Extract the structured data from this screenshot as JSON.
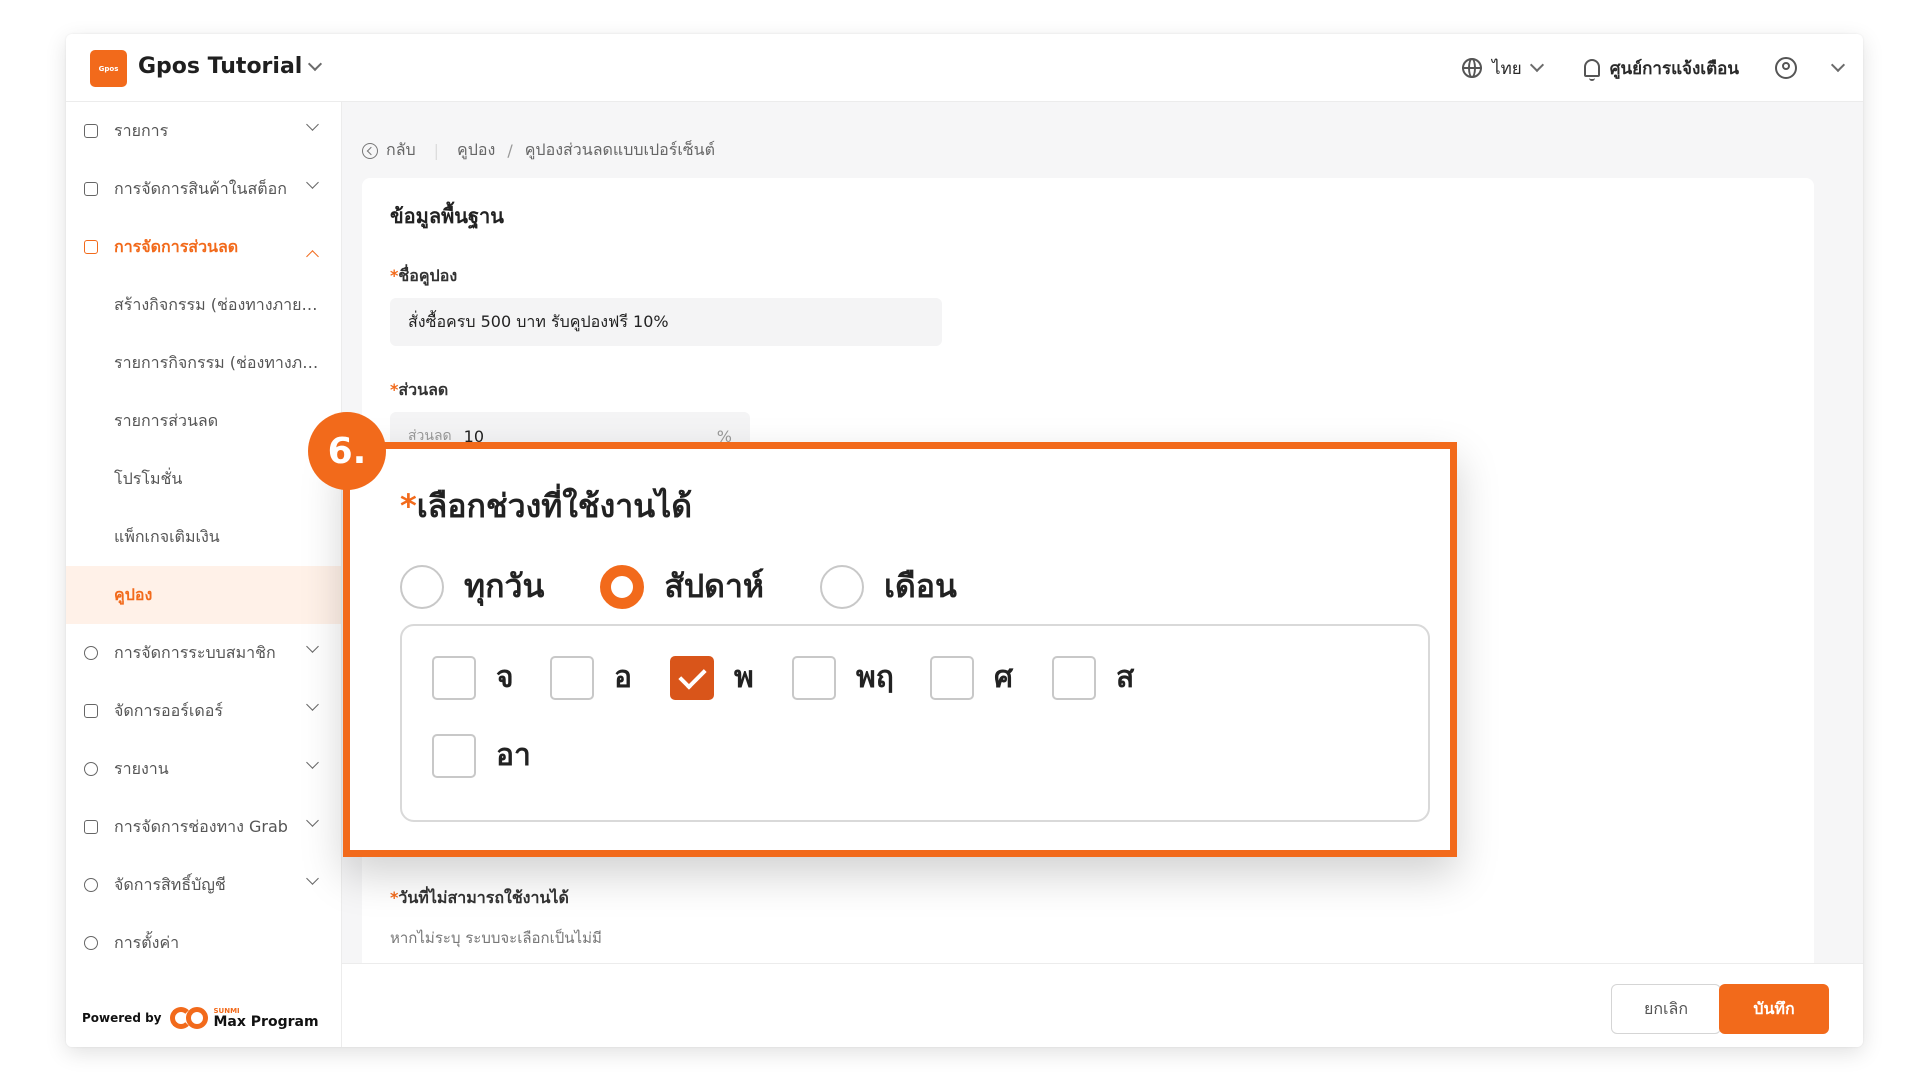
{
  "app": {
    "logo_text": "Gpos",
    "title": "Gpos Tutorial"
  },
  "topbar": {
    "language": "ไทย",
    "notifications": "ศูนย์การแจ้งเตือน"
  },
  "sidebar": {
    "items": [
      {
        "label": "รายการ"
      },
      {
        "label": "การจัดการสินค้าในสต็อก"
      },
      {
        "label": "การจัดการส่วนลด"
      },
      {
        "label": "การจัดการระบบสมาชิก"
      },
      {
        "label": "จัดการออร์เดอร์"
      },
      {
        "label": "รายงาน"
      },
      {
        "label": "การจัดการช่องทาง Grab"
      },
      {
        "label": "จัดการสิทธิ์บัญชี"
      },
      {
        "label": "การตั้งค่า"
      }
    ],
    "subitems": [
      {
        "label": "สร้างกิจกรรม (ช่องทางภายนอก)"
      },
      {
        "label": "รายการกิจกรรม (ช่องทางภายนอก)"
      },
      {
        "label": "รายการส่วนลด"
      },
      {
        "label": "โปรโมชั่น"
      },
      {
        "label": "แพ็กเกจเติมเงิน"
      },
      {
        "label": "คูปอง"
      }
    ],
    "powered_by": "Powered by",
    "powered_brand_top": "SUNMI",
    "powered_brand": "Max Program"
  },
  "breadcrumb": {
    "back": "กลับ",
    "parent": "คูปอง",
    "separator": "/",
    "current": "คูปองส่วนลดแบบเปอร์เซ็นต์"
  },
  "form": {
    "section_title": "ข้อมูลพื้นฐาน",
    "coupon_name_label": "ชื่อคูปอง",
    "coupon_name_value": "สั่งซื้อครบ 500 บาท รับคูปองฟรี 10%",
    "discount_label": "ส่วนลด",
    "discount_prefix": "ส่วนลด",
    "discount_value": "10",
    "discount_suffix": "%",
    "unavailable_label": "วันที่ไม่สามารถใช้งานได้",
    "unavailable_hint": "หากไม่ระบุ ระบบจะเลือกเป็นไม่มี",
    "required_mark": "*"
  },
  "callout": {
    "step": "6.",
    "title": "เลือกช่วงที่ใช้งานได้",
    "options": [
      {
        "label": "ทุกวัน",
        "selected": false
      },
      {
        "label": "สัปดาห์",
        "selected": true
      },
      {
        "label": "เดือน",
        "selected": false
      }
    ],
    "days": [
      {
        "label": "จ",
        "checked": false
      },
      {
        "label": "อ",
        "checked": false
      },
      {
        "label": "พ",
        "checked": true
      },
      {
        "label": "พฤ",
        "checked": false
      },
      {
        "label": "ศ",
        "checked": false
      },
      {
        "label": "ส",
        "checked": false
      },
      {
        "label": "อา",
        "checked": false
      }
    ]
  },
  "footer": {
    "cancel": "ยกเลิก",
    "save": "บันทึก"
  },
  "colors": {
    "accent": "#f26a1b",
    "checked": "#d9551a"
  }
}
